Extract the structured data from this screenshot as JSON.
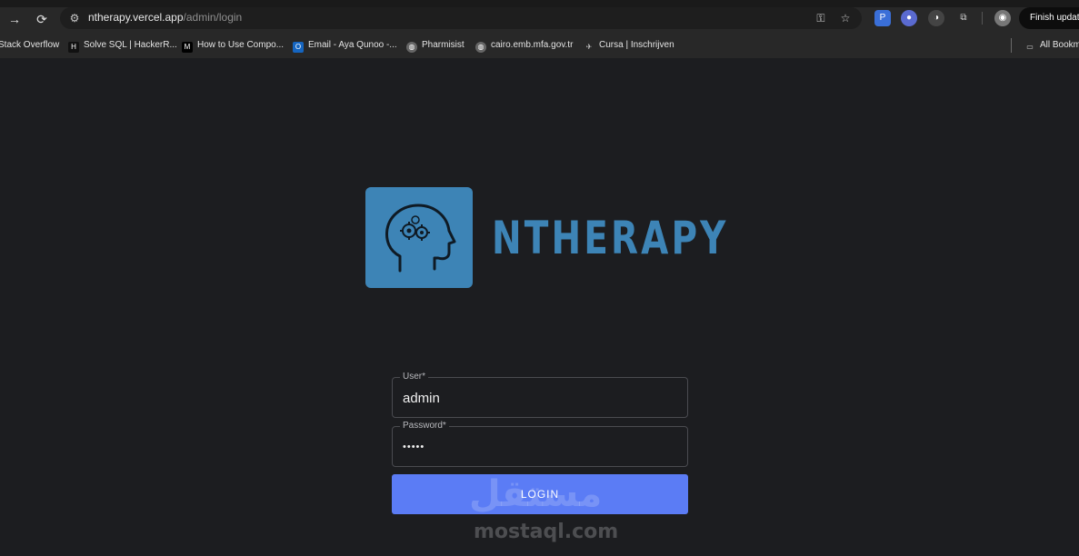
{
  "browser": {
    "url_host": "ntherapy.vercel.app",
    "url_path": "/admin/login",
    "finish_update_label": "Finish update",
    "all_bookmarks_label": "All Bookmarks"
  },
  "bookmarks": [
    {
      "label": "Stack Overflow",
      "icon": "stackoverflow-icon",
      "color": "#282828"
    },
    {
      "label": "Solve SQL | HackerR...",
      "icon": "hackerrank-icon",
      "color": "#1e1e1e"
    },
    {
      "label": "How to Use Compo...",
      "icon": "medium-icon",
      "color": "#000000"
    },
    {
      "label": "Email - Aya Qunoo -...",
      "icon": "outlook-icon",
      "color": "#1565c0"
    },
    {
      "label": "Pharmisist",
      "icon": "globe-icon",
      "color": "#555555"
    },
    {
      "label": "cairo.emb.mfa.gov.tr",
      "icon": "globe-icon",
      "color": "#555555"
    },
    {
      "label": "Cursa | Inschrijven",
      "icon": "cursa-icon",
      "color": "#555555"
    }
  ],
  "brand": {
    "name": "NTHERAPY",
    "color": "#3d84b6"
  },
  "form": {
    "user_label": "User*",
    "user_value": "admin",
    "password_label": "Password*",
    "password_value": "•••••",
    "login_label": "LOGIN",
    "button_color": "#5b7cf5"
  },
  "watermark": {
    "arabic": "مستقل",
    "latin": "mostaql.com"
  }
}
